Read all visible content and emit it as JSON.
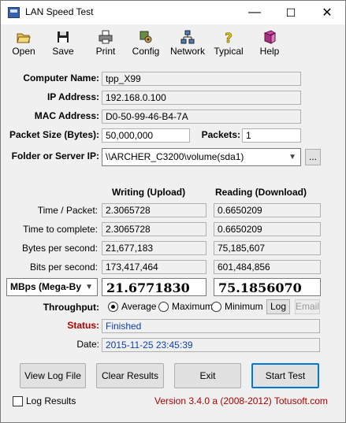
{
  "window": {
    "title": "LAN Speed Test"
  },
  "title_controls": {
    "minimize": "—",
    "maximize": "☐",
    "close": "✕"
  },
  "toolbar": {
    "items": [
      {
        "label": "Open",
        "icon": "open-folder-icon"
      },
      {
        "label": "Save",
        "icon": "floppy-disk-icon"
      },
      {
        "label": "Print",
        "icon": "printer-icon"
      },
      {
        "label": "Config",
        "icon": "config-icon"
      },
      {
        "label": "Network",
        "icon": "network-icon"
      },
      {
        "label": "Typical",
        "icon": "question-mark-icon"
      },
      {
        "label": "Help",
        "icon": "help-book-icon"
      }
    ]
  },
  "info": {
    "computer_name_label": "Computer Name:",
    "computer_name": "tpp_X99",
    "ip_label": "IP Address:",
    "ip": "192.168.0.100",
    "mac_label": "MAC Address:",
    "mac": "D0-50-99-46-B4-7A",
    "packet_size_label": "Packet Size (Bytes):",
    "packet_size": "50,000,000",
    "packets_label": "Packets:",
    "packets": "1",
    "folder_label": "Folder or Server IP:",
    "folder": "\\\\ARCHER_C3200\\volume(sda1)",
    "browse_label": "..."
  },
  "results": {
    "writing_header": "Writing (Upload)",
    "reading_header": "Reading (Download)",
    "rows": [
      {
        "label": "Time / Packet:",
        "write": "2.3065728",
        "read": "0.6650209"
      },
      {
        "label": "Time to complete:",
        "write": "2.3065728",
        "read": "0.6650209"
      },
      {
        "label": "Bytes per second:",
        "write": "21,677,183",
        "read": "75,185,607"
      },
      {
        "label": "Bits per second:",
        "write": "173,417,464",
        "read": "601,484,856"
      }
    ],
    "unit_select": "MBps (Mega-By",
    "write_big": "21.6771830",
    "read_big": "75.1856070"
  },
  "throughput": {
    "label": "Throughput:",
    "options": [
      "Average",
      "Maximum",
      "Minimum"
    ],
    "selected": "Average",
    "log_button": "Log",
    "email_button": "Email"
  },
  "status": {
    "label": "Status:",
    "value": "Finished",
    "date_label": "Date:",
    "date": "2015-11-25 23:45:39"
  },
  "buttons": {
    "view_log": "View Log File",
    "clear": "Clear Results",
    "exit": "Exit",
    "start": "Start Test"
  },
  "footer": {
    "log_results_label": "Log Results",
    "version": "Version 3.4.0  a (2008-2012) Totusoft.com"
  }
}
